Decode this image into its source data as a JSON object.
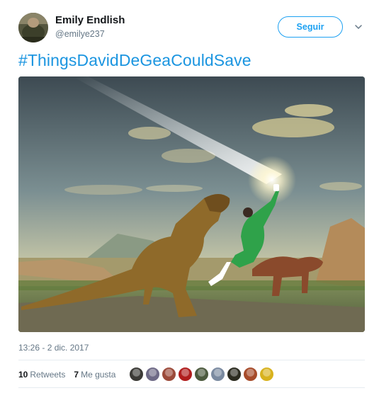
{
  "user": {
    "name": "Emily Endlish",
    "handle": "@emilye237"
  },
  "follow_label": "Seguir",
  "tweet_text": "#ThingsDavidDeGeaCouldSave",
  "timestamp": "13:26 - 2 dic. 2017",
  "stats": {
    "retweets_count": "10",
    "retweets_label": "Retweets",
    "likes_count": "7",
    "likes_label": "Me gusta"
  },
  "likers": [
    {
      "name": "liker-1",
      "color": "#3b3a36"
    },
    {
      "name": "liker-2",
      "color": "#6e6a86"
    },
    {
      "name": "liker-3",
      "color": "#9b4a3a"
    },
    {
      "name": "liker-4",
      "color": "#b01d1d"
    },
    {
      "name": "liker-5",
      "color": "#4c5a3e"
    },
    {
      "name": "liker-6",
      "color": "#7a8aa0"
    },
    {
      "name": "liker-7",
      "color": "#2b2b20"
    },
    {
      "name": "liker-8",
      "color": "#a64b2a"
    },
    {
      "name": "liker-9",
      "color": "#d8b21e"
    }
  ],
  "colors": {
    "accent": "#1da1f2",
    "hashtag": "#1b95e0",
    "muted": "#657786"
  }
}
